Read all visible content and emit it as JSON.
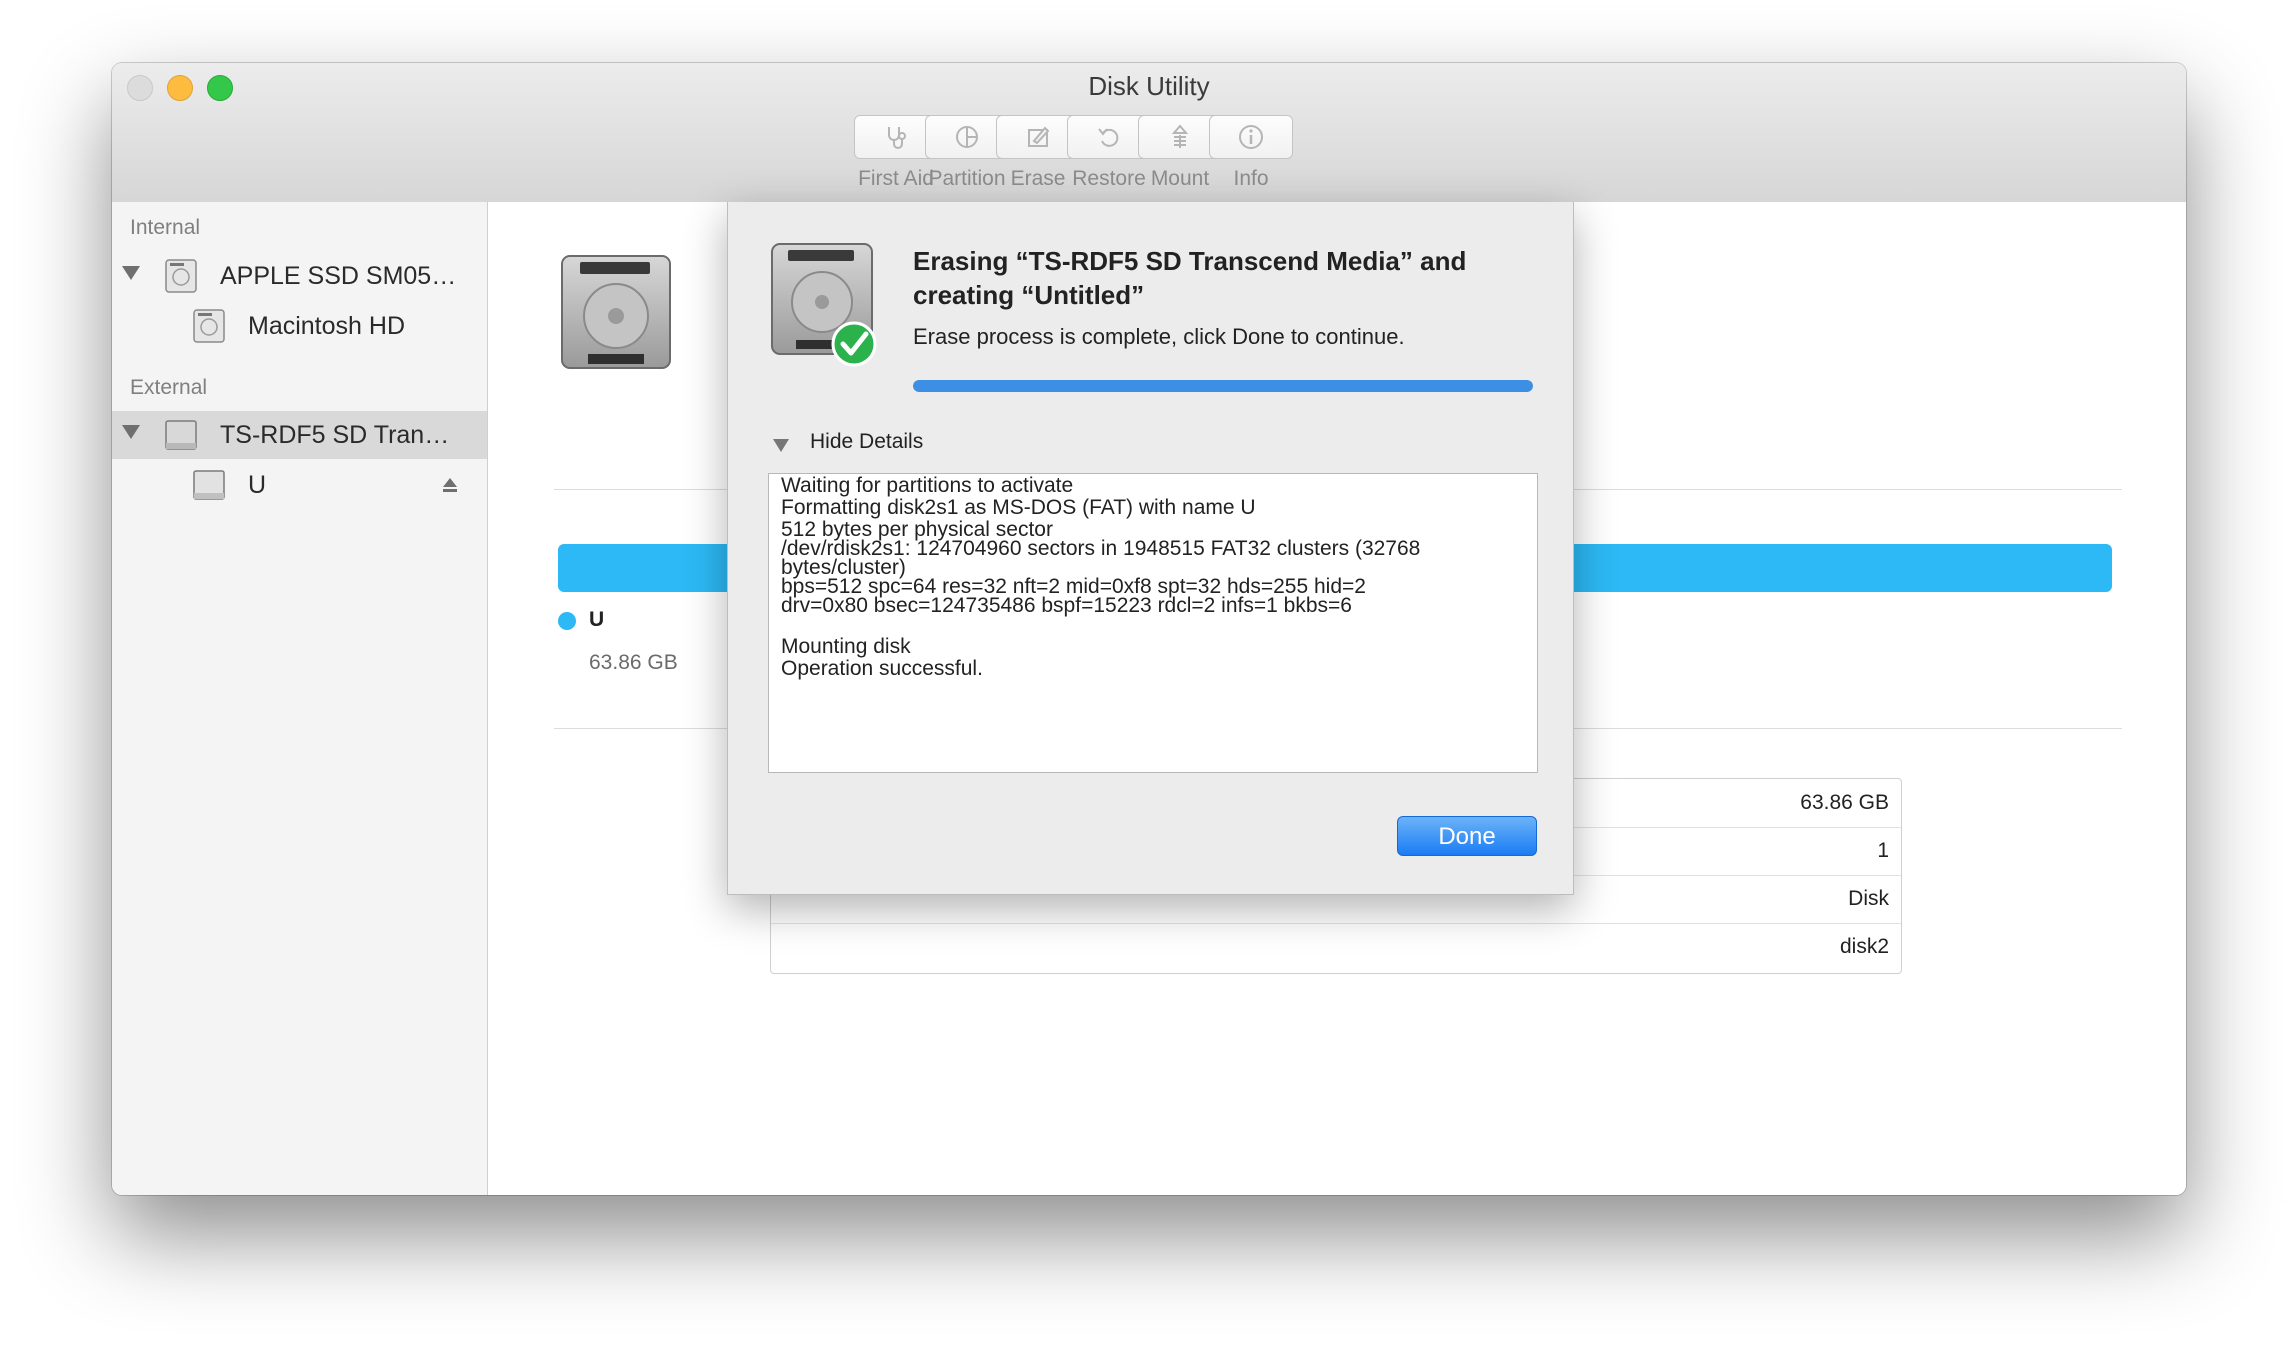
{
  "window": {
    "title": "Disk Utility"
  },
  "toolbar": {
    "items": [
      {
        "label": "First Aid",
        "icon": "stethoscope-icon"
      },
      {
        "label": "Partition",
        "icon": "pie-chart-icon"
      },
      {
        "label": "Erase",
        "icon": "pencil-eraser-icon"
      },
      {
        "label": "Restore",
        "icon": "restore-arrow-icon"
      },
      {
        "label": "Mount",
        "icon": "mount-icon"
      },
      {
        "label": "Info",
        "icon": "info-icon"
      }
    ]
  },
  "sidebar": {
    "internal_header": "Internal",
    "external_header": "External",
    "items": [
      {
        "label": "APPLE SSD SM05…"
      },
      {
        "label": "Macintosh HD"
      },
      {
        "label": "TS-RDF5 SD Tran…"
      },
      {
        "label": "U"
      }
    ]
  },
  "main": {
    "volume_name": "U",
    "volume_size": "63.86 GB",
    "info_values": [
      "63.86 GB",
      "1",
      "Disk",
      "disk2"
    ]
  },
  "sheet": {
    "title": "Erasing “TS-RDF5 SD Transcend Media” and creating “Untitled”",
    "status": "Erase process is complete, click Done to continue.",
    "progress": 1.0,
    "details_toggle": "Hide Details",
    "log_lines": [
      "Waiting for partitions to activate",
      "Formatting disk2s1 as MS-DOS (FAT) with name U",
      "512 bytes per physical sector",
      "/dev/rdisk2s1: 124704960 sectors in 1948515 FAT32 clusters (32768",
      "bytes/cluster)",
      "bps=512 spc=64 res=32 nft=2 mid=0xf8 spt=32 hds=255 hid=2",
      "drv=0x80 bsec=124735486 bspf=15223 rdcl=2 infs=1 bkbs=6",
      "",
      "Mounting disk",
      "Operation successful."
    ],
    "done_label": "Done"
  },
  "colors": {
    "accent": "#2cb9f5",
    "progress": "#3d8fe6",
    "button": "#1a7cf2",
    "success_check": "#2bb24c"
  }
}
